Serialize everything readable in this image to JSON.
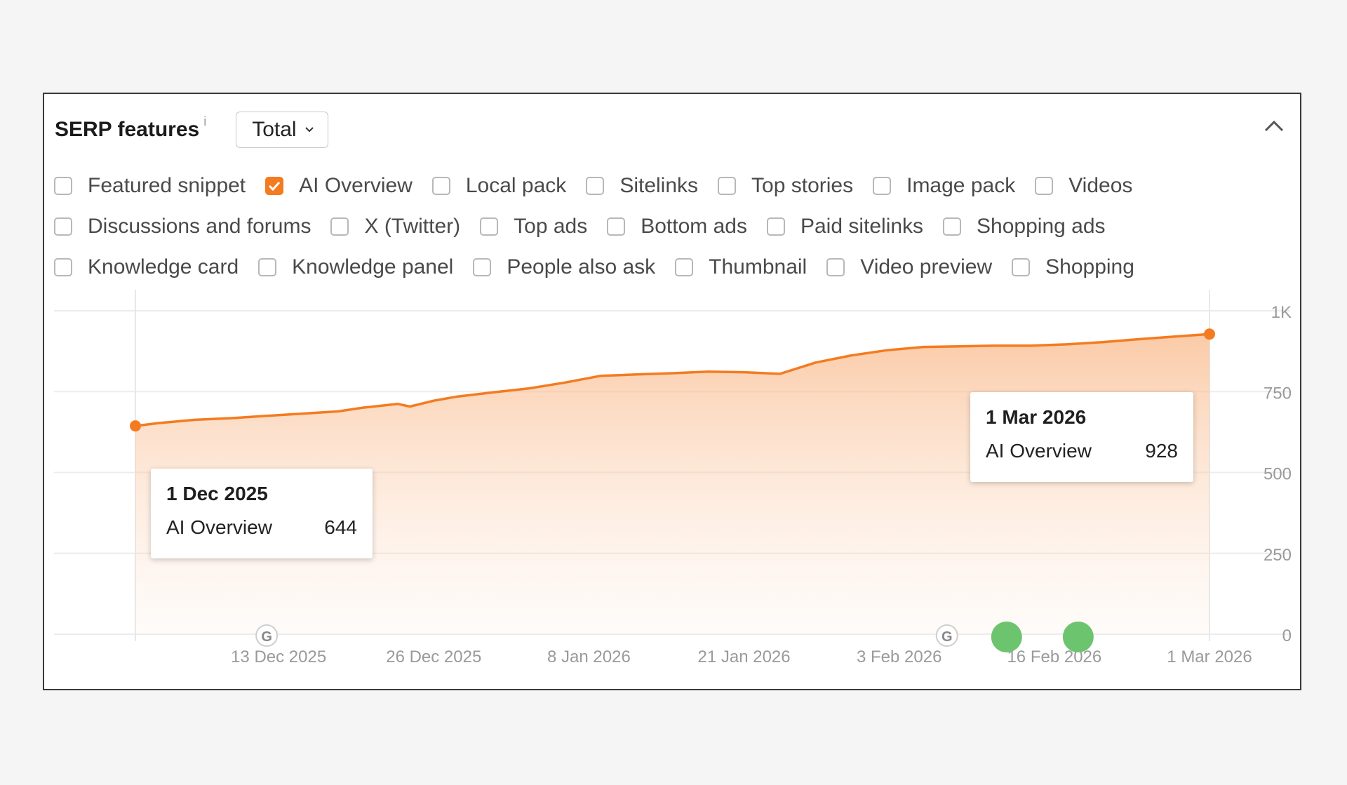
{
  "header": {
    "title": "SERP features",
    "info_icon": "i",
    "dropdown_value": "Total"
  },
  "filters": [
    [
      {
        "label": "Featured snippet",
        "checked": false
      },
      {
        "label": "AI Overview",
        "checked": true
      },
      {
        "label": "Local pack",
        "checked": false
      },
      {
        "label": "Sitelinks",
        "checked": false
      },
      {
        "label": "Top stories",
        "checked": false
      },
      {
        "label": "Image pack",
        "checked": false
      },
      {
        "label": "Videos",
        "checked": false
      }
    ],
    [
      {
        "label": "Discussions and forums",
        "checked": false
      },
      {
        "label": "X (Twitter)",
        "checked": false
      },
      {
        "label": "Top ads",
        "checked": false
      },
      {
        "label": "Bottom ads",
        "checked": false
      },
      {
        "label": "Paid sitelinks",
        "checked": false
      },
      {
        "label": "Shopping ads",
        "checked": false
      }
    ],
    [
      {
        "label": "Knowledge card",
        "checked": false
      },
      {
        "label": "Knowledge panel",
        "checked": false
      },
      {
        "label": "People also ask",
        "checked": false
      },
      {
        "label": "Thumbnail",
        "checked": false
      },
      {
        "label": "Video preview",
        "checked": false
      },
      {
        "label": "Shopping",
        "checked": false
      }
    ]
  ],
  "colors": {
    "line": "#f47b20",
    "accent": "#f47b20",
    "marker_green": "#6cc46f",
    "grid": "#ececec"
  },
  "chart_data": {
    "type": "area",
    "series": [
      {
        "name": "AI Overview",
        "x": [
          "2025-12-01",
          "2025-12-03",
          "2025-12-06",
          "2025-12-09",
          "2025-12-12",
          "2025-12-15",
          "2025-12-18",
          "2025-12-20",
          "2025-12-23",
          "2025-12-24",
          "2025-12-26",
          "2025-12-28",
          "2025-12-31",
          "2026-01-03",
          "2026-01-06",
          "2026-01-09",
          "2026-01-12",
          "2026-01-15",
          "2026-01-18",
          "2026-01-21",
          "2026-01-24",
          "2026-01-27",
          "2026-01-30",
          "2026-02-02",
          "2026-02-05",
          "2026-02-08",
          "2026-02-11",
          "2026-02-14",
          "2026-02-17",
          "2026-02-20",
          "2026-02-23",
          "2026-02-26",
          "2026-03-01"
        ],
        "values": [
          644,
          653,
          663,
          668,
          675,
          682,
          689,
          700,
          712,
          704,
          722,
          735,
          748,
          760,
          778,
          799,
          803,
          807,
          812,
          810,
          805,
          840,
          862,
          878,
          888,
          890,
          892,
          892,
          896,
          903,
          912,
          920,
          928
        ]
      }
    ],
    "x_ticks": [
      "13 Dec 2025",
      "26 Dec 2025",
      "8 Jan 2026",
      "21 Jan 2026",
      "3 Feb 2026",
      "16 Feb 2026",
      "1 Mar 2026"
    ],
    "y_ticks": [
      "0",
      "250",
      "500",
      "750",
      "1K"
    ],
    "ylim": [
      0,
      1000
    ],
    "xlim": [
      "2025-12-01",
      "2026-03-01"
    ],
    "grid": true,
    "annotations": [
      {
        "date": "1 Dec 2025",
        "label": "AI Overview",
        "value": "644"
      },
      {
        "date": "1 Mar 2026",
        "label": "AI Overview",
        "value": "928"
      }
    ],
    "event_markers": [
      {
        "type": "google-update",
        "date": "2025-12-12"
      },
      {
        "type": "google-update",
        "date": "2026-02-07"
      },
      {
        "type": "event",
        "date": "2026-02-12"
      },
      {
        "type": "event",
        "date": "2026-02-18"
      }
    ]
  }
}
